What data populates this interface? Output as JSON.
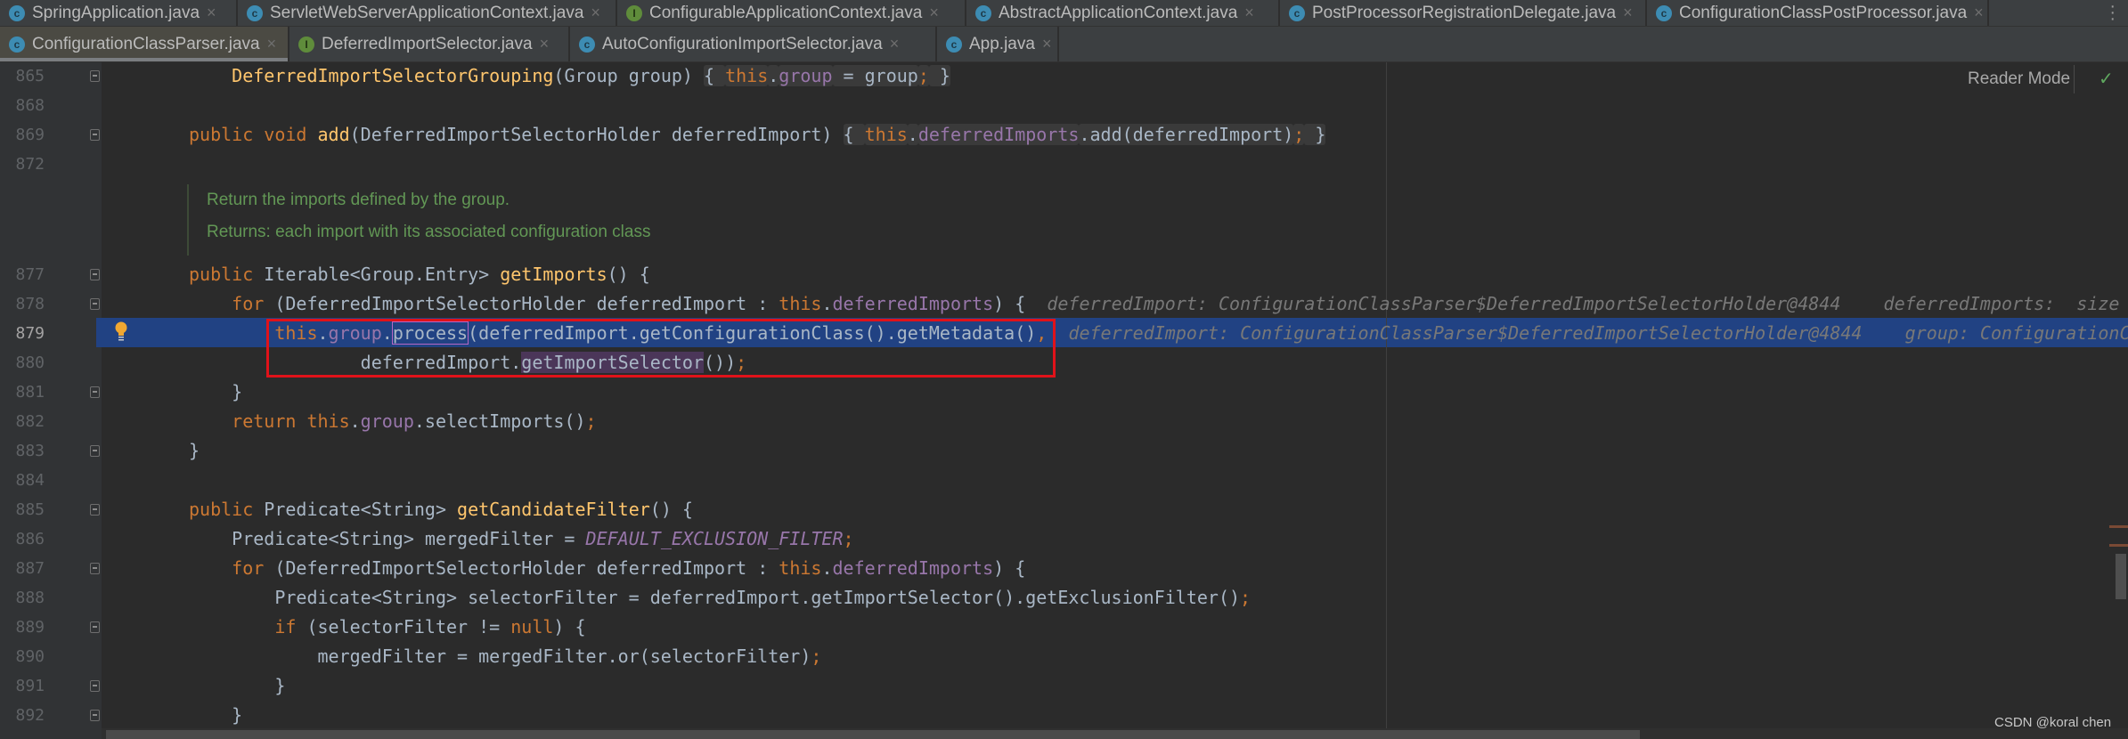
{
  "tabs_row1": [
    {
      "label": "SpringApplication.java",
      "icon": "c",
      "w": 267
    },
    {
      "label": "ServletWebServerApplicationContext.java",
      "icon": "c",
      "w": 426
    },
    {
      "label": "ConfigurableApplicationContext.java",
      "icon": "i",
      "w": 392
    },
    {
      "label": "AbstractApplicationContext.java",
      "icon": "c",
      "w": 352
    },
    {
      "label": "PostProcessorRegistrationDelegate.java",
      "icon": "c",
      "w": 412
    },
    {
      "label": "ConfigurationClassPostProcessor.java",
      "icon": "c",
      "w": 384
    }
  ],
  "tabs_row2": [
    {
      "label": "ConfigurationClassParser.java",
      "icon": "c",
      "w": 325,
      "active": true
    },
    {
      "label": "DeferredImportSelector.java",
      "icon": "i",
      "w": 315
    },
    {
      "label": "AutoConfigurationImportSelector.java",
      "icon": "c",
      "w": 412
    },
    {
      "label": "App.java",
      "icon": "c",
      "w": 137
    }
  ],
  "close_glyph": "×",
  "reader_mode": "Reader Mode",
  "watermark": "CSDN @koral chen",
  "colors": {
    "background": "#2b2b2b",
    "keyword": "#cc7832",
    "method": "#ffc66d",
    "field": "#9876aa",
    "text": "#a9b7c6",
    "doc": "#629755",
    "current_line": "#214283",
    "annotation_box": "#e0121a"
  },
  "doc": [
    "Return the imports defined by the group.",
    "Returns: each import with its associated configuration class"
  ],
  "current_line": 879,
  "lines": [
    {
      "n": 865,
      "fold": true,
      "tokens": [
        [
          "",
          "    "
        ],
        [
          "fn",
          "DeferredImportSelectorGrouping"
        ],
        [
          "",
          "(Group group) "
        ],
        [
          "fb",
          "{ "
        ],
        [
          "kw fb",
          "this"
        ],
        [
          "fb",
          "."
        ],
        [
          "fld fb",
          "group"
        ],
        [
          "fb",
          " = group"
        ],
        [
          "kw fb",
          ";"
        ],
        [
          "fb",
          " }"
        ]
      ]
    },
    {
      "n": 868,
      "tokens": []
    },
    {
      "n": 869,
      "fold": true,
      "tokens": [
        [
          "kw",
          "public void "
        ],
        [
          "fn",
          "add"
        ],
        [
          "",
          "(DeferredImportSelectorHolder deferredImport) "
        ],
        [
          "fb",
          "{ "
        ],
        [
          "kw fb",
          "this"
        ],
        [
          "fb",
          "."
        ],
        [
          "fld fb",
          "deferredImports"
        ],
        [
          "fb",
          ".add(deferredImport)"
        ],
        [
          "kw fb",
          ";"
        ],
        [
          "fb",
          " }"
        ]
      ]
    },
    {
      "n": 872,
      "tokens": []
    },
    {
      "n": 877,
      "fold": true,
      "tokens": [
        [
          "kw",
          "public "
        ],
        [
          "",
          "Iterable<Group.Entry> "
        ],
        [
          "fn",
          "getImports"
        ],
        [
          "",
          "() {"
        ]
      ]
    },
    {
      "n": 878,
      "fold": true,
      "tokens": [
        [
          "",
          "    "
        ],
        [
          "kw",
          "for "
        ],
        [
          "",
          "(DeferredImportSelectorHolder deferredImport : "
        ],
        [
          "kw",
          "this"
        ],
        [
          "",
          "."
        ],
        [
          "fld",
          "deferredImports"
        ],
        [
          "",
          ") {  "
        ],
        [
          "hint",
          "deferredImport: ConfigurationClassParser$DeferredImportSelectorHolder@4844    deferredImports:  size"
        ]
      ]
    },
    {
      "n": 879,
      "tokens": [
        [
          "",
          "        "
        ],
        [
          "kw",
          "this"
        ],
        [
          "",
          "."
        ],
        [
          "fld",
          "group"
        ],
        [
          "",
          "."
        ],
        [
          "proc",
          "process"
        ],
        [
          "",
          "(deferredImport.getConfigurationClass().getMetadata()"
        ],
        [
          "kw",
          ","
        ],
        [
          "",
          "  "
        ],
        [
          "hint",
          "deferredImport: ConfigurationClassParser$DeferredImportSelectorHolder@4844    group: ConfigurationC"
        ]
      ]
    },
    {
      "n": 880,
      "tokens": [
        [
          "",
          "                deferredImport."
        ],
        [
          "sel",
          "getImportSelector"
        ],
        [
          "",
          "())"
        ],
        [
          "kw",
          ";"
        ]
      ]
    },
    {
      "n": 881,
      "fold": true,
      "tokens": [
        [
          "",
          "    }"
        ]
      ]
    },
    {
      "n": 882,
      "tokens": [
        [
          "",
          "    "
        ],
        [
          "kw",
          "return this"
        ],
        [
          "",
          "."
        ],
        [
          "fld",
          "group"
        ],
        [
          "",
          ".selectImports()"
        ],
        [
          "kw",
          ";"
        ]
      ]
    },
    {
      "n": 883,
      "fold": true,
      "tokens": [
        [
          "",
          "}"
        ]
      ]
    },
    {
      "n": 884,
      "tokens": []
    },
    {
      "n": 885,
      "fold": true,
      "tokens": [
        [
          "kw",
          "public "
        ],
        [
          "",
          "Predicate<String> "
        ],
        [
          "fn",
          "getCandidateFilter"
        ],
        [
          "",
          "() {"
        ]
      ]
    },
    {
      "n": 886,
      "tokens": [
        [
          "",
          "    Predicate<String> mergedFilter = "
        ],
        [
          "it",
          "DEFAULT_EXCLUSION_FILTER"
        ],
        [
          "kw",
          ";"
        ]
      ]
    },
    {
      "n": 887,
      "fold": true,
      "tokens": [
        [
          "",
          "    "
        ],
        [
          "kw",
          "for "
        ],
        [
          "",
          "(DeferredImportSelectorHolder deferredImport : "
        ],
        [
          "kw",
          "this"
        ],
        [
          "",
          "."
        ],
        [
          "fld",
          "deferredImports"
        ],
        [
          "",
          ") {"
        ]
      ]
    },
    {
      "n": 888,
      "tokens": [
        [
          "",
          "        Predicate<String> selectorFilter = deferredImport.getImportSelector().getExclusionFilter()"
        ],
        [
          "kw",
          ";"
        ]
      ]
    },
    {
      "n": 889,
      "fold": true,
      "tokens": [
        [
          "",
          "        "
        ],
        [
          "kw",
          "if "
        ],
        [
          "",
          "(selectorFilter != "
        ],
        [
          "kw",
          "null"
        ],
        [
          "",
          ") {"
        ]
      ]
    },
    {
      "n": 890,
      "tokens": [
        [
          "",
          "            mergedFilter = mergedFilter.or(selectorFilter)"
        ],
        [
          "kw",
          ";"
        ]
      ]
    },
    {
      "n": 891,
      "fold": true,
      "tokens": [
        [
          "",
          "        }"
        ]
      ]
    },
    {
      "n": 892,
      "fold": true,
      "tokens": [
        [
          "",
          "    }"
        ]
      ]
    }
  ]
}
